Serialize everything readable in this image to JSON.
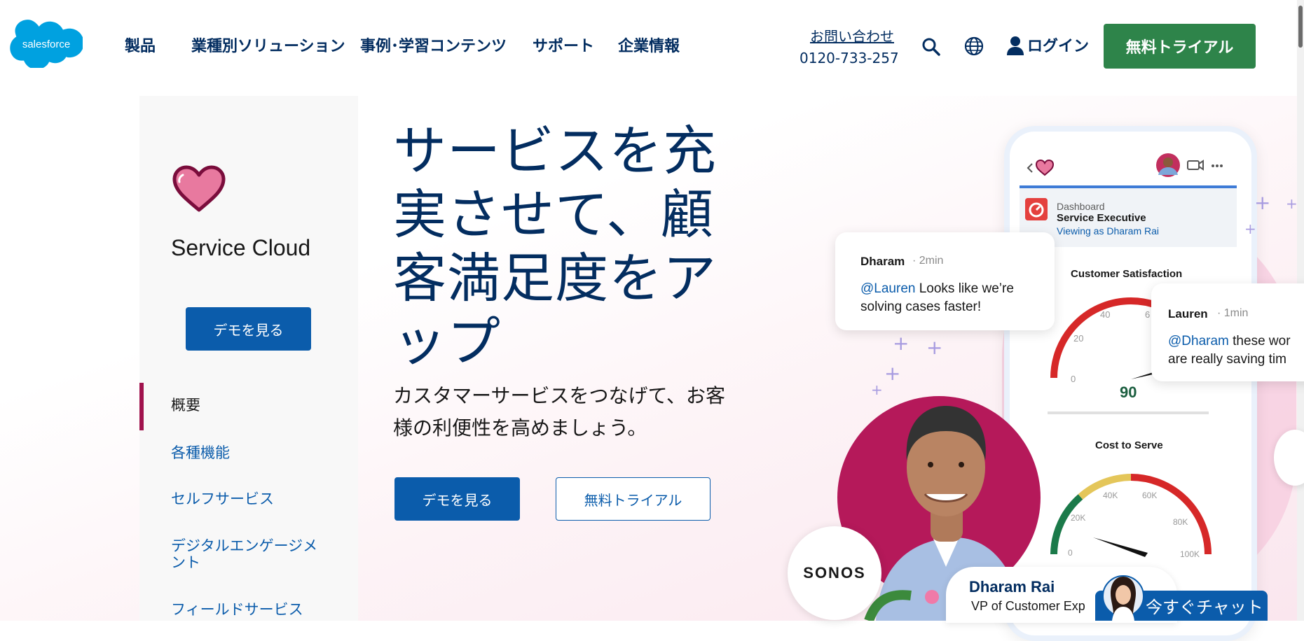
{
  "header": {
    "logo_text": "salesforce",
    "nav": [
      "製品",
      "業種別ソリューション",
      "事例･学習コンテンツ",
      "サポート",
      "企業情報"
    ],
    "contact_label": "お問い合わせ",
    "contact_phone": "0120-733-257",
    "search_icon": "search-icon",
    "globe_icon": "globe-icon",
    "user_icon": "user-icon",
    "login_label": "ログイン",
    "trial_label": "無料トライアル",
    "accent_color": "#2e844a"
  },
  "sidebar": {
    "product_icon": "heart-icon",
    "product_name": "Service Cloud",
    "demo_label": "デモを見る",
    "links": [
      {
        "label": "概要",
        "active": true
      },
      {
        "label": "各種機能",
        "active": false
      },
      {
        "label": "セルフサービス",
        "active": false
      },
      {
        "label": "デジタルエンゲージメント",
        "active": false
      },
      {
        "label": "フィールドサービス",
        "active": false
      }
    ]
  },
  "hero": {
    "title": "サービスを充実させて、顧客満足度をアップ",
    "subtitle": "カスタマーサービスをつなげて、お客様の利便性を高めましょう。",
    "demo_label": "デモを見る",
    "trial_label": "無料トライアル"
  },
  "illustration": {
    "dashboard_label": "Dashboard",
    "dashboard_title": "Service Executive",
    "dashboard_viewing": "Viewing as Dharam Rai",
    "gauge1_title": "Customer Satisfaction",
    "gauge1_value": "90",
    "gauge1_ticks": [
      "0",
      "20",
      "40",
      "6"
    ],
    "gauge2_title": "Cost to Serve",
    "gauge2_ticks": [
      "0",
      "20K",
      "40K",
      "60K",
      "80K",
      "100K"
    ],
    "chat1": {
      "name": "Dharam",
      "time": "· 2min",
      "mention": "@Lauren",
      "line1": " Looks like we’re",
      "line2": "solving cases faster!"
    },
    "chat2": {
      "name": "Lauren",
      "time": "· 1min",
      "mention": "@Dharam",
      "line1": " these wor",
      "line2": "are really saving tim"
    },
    "customer_logo": "SONOS",
    "person_name": "Dharam Rai",
    "person_title": "VP of Customer Exp"
  },
  "chat_widget": {
    "label": "今すぐチャット"
  }
}
